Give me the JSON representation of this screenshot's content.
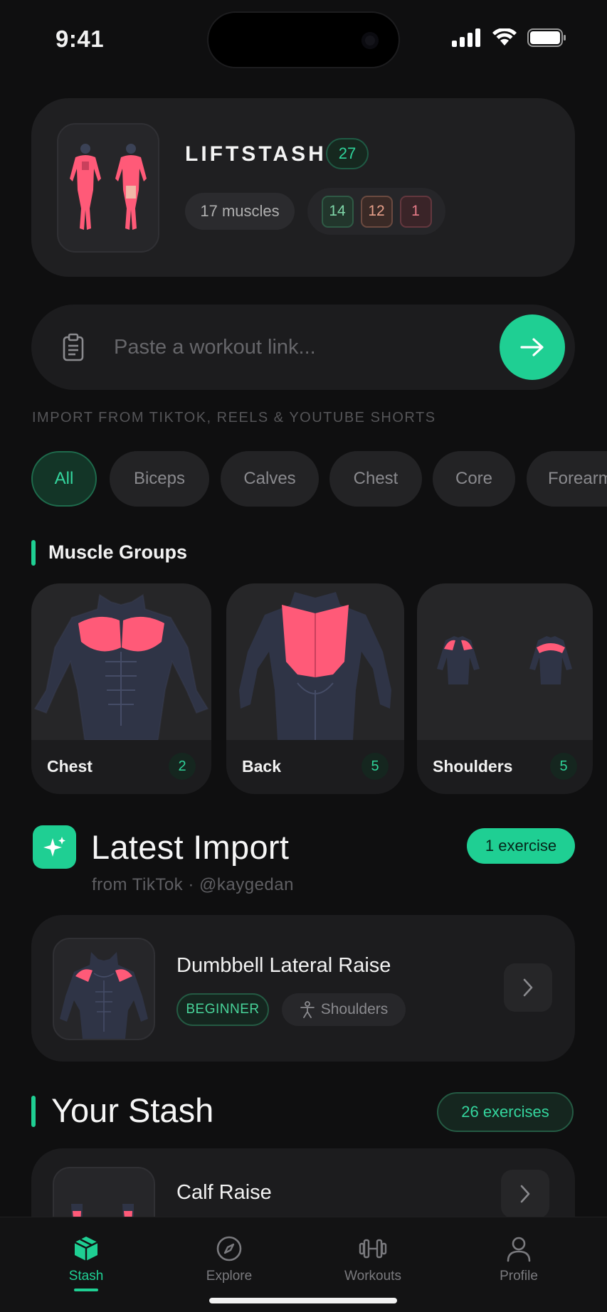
{
  "status": {
    "time": "9:41"
  },
  "hero": {
    "brand": "LIFTSTASH",
    "count": "27",
    "muscles": "17 muscles",
    "levels": {
      "beginner": "14",
      "intermediate": "12",
      "advanced": "1"
    }
  },
  "link": {
    "placeholder": "Paste a workout link...",
    "hint": "IMPORT FROM TIKTOK, REELS & YOUTUBE SHORTS"
  },
  "chips": [
    "All",
    "Biceps",
    "Calves",
    "Chest",
    "Core",
    "Forearms"
  ],
  "muscle_groups": {
    "title": "Muscle Groups",
    "items": [
      {
        "name": "Chest",
        "count": "2"
      },
      {
        "name": "Back",
        "count": "5"
      },
      {
        "name": "Shoulders",
        "count": "5"
      }
    ]
  },
  "latest": {
    "title": "Latest Import",
    "source": "from TikTok · @kaygedan",
    "count_label": "1 exercise",
    "exercise": {
      "name": "Dumbbell Lateral Raise",
      "level": "BEGINNER",
      "muscle": "Shoulders"
    }
  },
  "stash": {
    "title": "Your Stash",
    "count_label": "26 exercises",
    "first": {
      "name": "Calf Raise"
    }
  },
  "tabs": [
    {
      "label": "Stash",
      "icon": "box-icon",
      "active": true
    },
    {
      "label": "Explore",
      "icon": "compass-icon",
      "active": false
    },
    {
      "label": "Workouts",
      "icon": "dumbbell-icon",
      "active": false
    },
    {
      "label": "Profile",
      "icon": "user-icon",
      "active": false
    }
  ],
  "colors": {
    "accent": "#1fcf93",
    "muscle": "#ff5a78",
    "background": "#0f0f10",
    "card": "#1c1c1e"
  }
}
